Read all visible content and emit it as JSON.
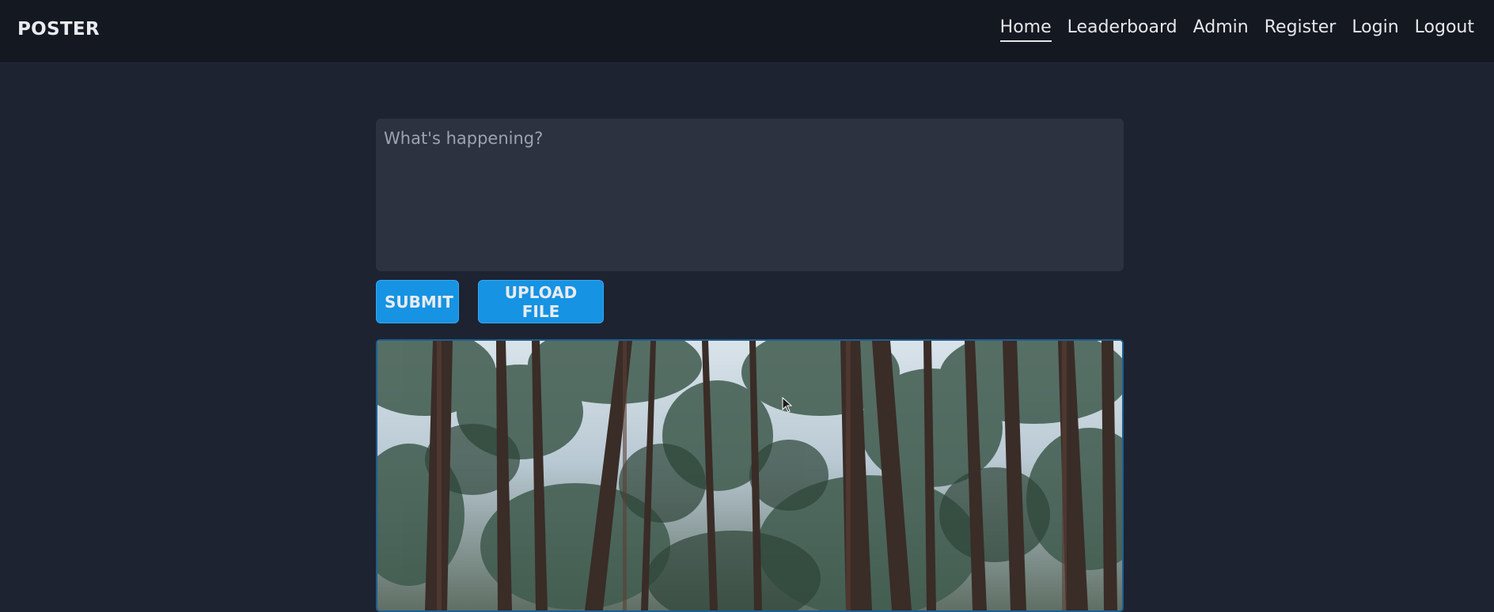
{
  "app": {
    "brand": "POSTER"
  },
  "nav": {
    "items": [
      {
        "label": "Home",
        "active": true
      },
      {
        "label": "Leaderboard",
        "active": false
      },
      {
        "label": "Admin",
        "active": false
      },
      {
        "label": "Register",
        "active": false
      },
      {
        "label": "Login",
        "active": false
      },
      {
        "label": "Logout",
        "active": false
      }
    ]
  },
  "composer": {
    "placeholder": "What's happening?",
    "value": ""
  },
  "actions": {
    "submit_label": "SUBMIT",
    "upload_label": "UPLOAD FILE"
  },
  "colors": {
    "accent": "#1693e3",
    "background": "#1d2331",
    "navbar": "#141821",
    "input": "#2c3240"
  },
  "post": {
    "image_subject": "forest canopy photo"
  }
}
